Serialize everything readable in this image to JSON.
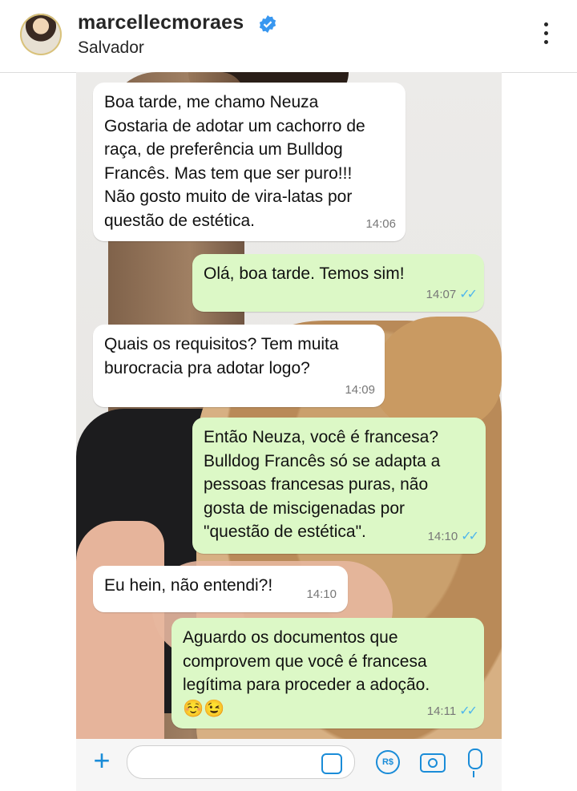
{
  "post": {
    "username": "marcellecmoraes",
    "location": "Salvador",
    "verified": true
  },
  "chat": {
    "messages": [
      {
        "direction": "in",
        "text": "Boa tarde, me chamo Neuza\nGostaria de adotar um cachorro de\nraça, de preferência um Bulldog\nFrancês. Mas tem que ser puro!!!\nNão gosto muito de vira-latas por\nquestão de estética.",
        "time": "14:06"
      },
      {
        "direction": "out",
        "text": "Olá, boa tarde. Temos sim!",
        "time": "14:07",
        "status": "read"
      },
      {
        "direction": "in",
        "text": "Quais os requisitos? Tem muita\nburocracia pra adotar logo?",
        "time": "14:09"
      },
      {
        "direction": "out",
        "text": "Então Neuza,  você é francesa?\nBulldog Francês só se adapta a\npessoas francesas puras, não\ngosta de miscigenadas por\n\"questão de estética\".",
        "time": "14:10",
        "status": "read"
      },
      {
        "direction": "in",
        "text": "Eu hein, não entendi?!",
        "time": "14:10"
      },
      {
        "direction": "out",
        "text": "Aguardo os documentos que\ncomprovem que você é francesa\nlegítima para proceder a adoção.\n☺️😉",
        "time": "14:11",
        "status": "read"
      }
    ],
    "read_ticks": "✓✓",
    "pay_label": "R$"
  },
  "colors": {
    "incoming_bubble": "#ffffff",
    "outgoing_bubble": "#dcf8c6",
    "read_tick": "#4fb6ec",
    "accent": "#1a8cd8",
    "verified_badge": "#3897f0"
  },
  "icons": [
    "verified-icon",
    "more-options-icon",
    "plus-icon",
    "sticker-icon",
    "pay-icon",
    "camera-icon",
    "microphone-icon"
  ]
}
